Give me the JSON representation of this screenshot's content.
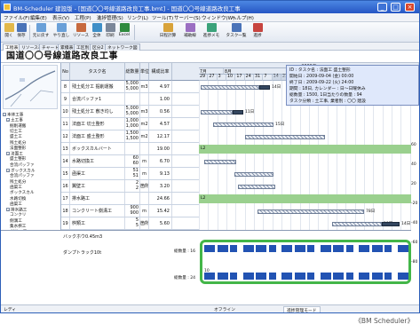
{
  "window": {
    "title": "BM-Scheduler 建設版 - [国道〇〇号線道路改良工事.bmt] - 国道〇〇号線道路改良工事",
    "controls": [
      "_",
      "□",
      "×"
    ]
  },
  "menubar": [
    "ファイル(F)",
    "編集(E)",
    "表示(V)",
    "工程(P)",
    "進捗管理(S)",
    "リンク(L)",
    "ツール(T)",
    "サーバー(S)",
    "ウィンドウ(W)",
    "ヘルプ(H)"
  ],
  "toolbar": [
    {
      "label": "開く",
      "icon": "folder-icon",
      "color": "#e2b84a"
    },
    {
      "label": "保存",
      "icon": "save-icon",
      "color": "#4a73b8"
    },
    {
      "label": "元に戻す",
      "icon": "undo-icon",
      "color": "#6aa0d8"
    },
    {
      "label": "やり直し",
      "icon": "redo-icon",
      "color": "#6aa0d8"
    },
    {
      "label": "リソース",
      "icon": "resource-icon",
      "color": "#c76a3f"
    },
    {
      "label": "全体",
      "icon": "overview-icon",
      "color": "#3f8fc7"
    },
    {
      "label": "印刷",
      "icon": "print-icon",
      "color": "#7b8799"
    },
    {
      "label": "Excel",
      "icon": "excel-icon",
      "color": "#2e8a3e"
    },
    {
      "label": "日程計算",
      "icon": "calc-icon",
      "color": "#d8a33a"
    },
    {
      "label": "補助線",
      "icon": "guide-icon",
      "color": "#9b6fc2"
    },
    {
      "label": "進捗メモ",
      "icon": "memo-icon",
      "color": "#3aa27a"
    },
    {
      "label": "タスク一覧",
      "icon": "tasklist-icon",
      "color": "#4a73b8"
    },
    {
      "label": "進捗",
      "icon": "progress-icon",
      "color": "#c7443f"
    }
  ],
  "tabs": [
    "工程表",
    "リソース表",
    "チャート",
    "累積表",
    "工区別",
    "区分2",
    "ネットワーク図"
  ],
  "project_title": "国道〇〇号線道路改良工事",
  "table": {
    "headers": {
      "no": "No",
      "name": "タスク名",
      "qty": "総数量",
      "unit": "単位",
      "completed": "構成比率"
    },
    "rows": [
      {
        "no": "8",
        "name": "残土処分工 掘削運搬",
        "qty": [
          "5,000",
          "5,000"
        ],
        "unit": "m3",
        "completed": "4.97"
      },
      {
        "no": "9",
        "name": "合流パッファ1",
        "qty": [],
        "unit": "",
        "completed": "1.00"
      },
      {
        "no": "10",
        "name": "残土処分工 敷き均し",
        "qty": [
          "5,000",
          "5,000"
        ],
        "unit": "m3",
        "completed": "0.56"
      },
      {
        "no": "11",
        "name": "法面工 切土整形",
        "qty": [
          "1,000",
          "1,000"
        ],
        "unit": "m2",
        "completed": "4.57"
      },
      {
        "no": "12",
        "name": "法面工 盛土整形",
        "qty": [
          "1,500",
          "1,500"
        ],
        "unit": "m2",
        "completed": "12.17"
      },
      {
        "no": "13",
        "name": "ボックスカルバート",
        "qty": [],
        "unit": "",
        "completed": "19.00"
      },
      {
        "no": "14",
        "name": "水路切換工",
        "qty": [
          "60",
          "60"
        ],
        "unit": "m",
        "completed": "6.70"
      },
      {
        "no": "15",
        "name": "函渠工",
        "qty": [
          "51",
          "51"
        ],
        "unit": "m",
        "completed": "9.13"
      },
      {
        "no": "16",
        "name": "翼壁工",
        "qty": [
          "2",
          "2"
        ],
        "unit": "箇所",
        "completed": "3.20"
      },
      {
        "no": "17",
        "name": "排水路工",
        "qty": [],
        "unit": "",
        "completed": "24.66"
      },
      {
        "no": "18",
        "name": "コンクリート側溝工",
        "qty": [
          "900",
          "900"
        ],
        "unit": "m",
        "completed": "15.42"
      },
      {
        "no": "19",
        "name": "桝類工",
        "qty": [
          "5",
          "5"
        ],
        "unit": "箇所",
        "completed": "5.60"
      }
    ]
  },
  "tree": [
    "本体工事",
    "土工事",
    "掘削運搬",
    "切土工",
    "盛土工",
    "残土処分",
    "法面整形",
    "法面工",
    "盛土整形",
    "合流パッファ",
    "ボックスカル",
    "合流パッファ",
    "残土処分",
    "函渠工",
    "ボックスカル",
    "水路切換",
    "函渠工",
    "排水路工",
    "コンクリ",
    "側溝工",
    "集水桝工",
    "舗装工事",
    "下層路盤",
    "上層路盤",
    "表層工",
    "舗装版",
    "付帯工事",
    "区画線工",
    "ガードレ",
    "交通標識",
    "仮設工事"
  ],
  "gantt": {
    "year_label": "2009年",
    "months": [
      "7月",
      "8月",
      "9月",
      "10月"
    ],
    "days": [
      "29",
      "27",
      "3",
      "10",
      "17",
      "24",
      "31",
      "7",
      "14",
      "21",
      "28",
      "5",
      "12",
      "19",
      "26",
      "2",
      "9",
      "16",
      "23",
      "30",
      "6",
      "13",
      "20",
      "27"
    ],
    "bar_labels": {
      "r8": "14日",
      "r10": "11日",
      "r11": "15日",
      "r13": "L2",
      "r17": "L2",
      "r18": "78日",
      "r19": "19日",
      "r19b": "14日"
    },
    "right_scale": [
      "60",
      "40",
      "20",
      "-20",
      "-40",
      "-60",
      "-80"
    ]
  },
  "tooltip": {
    "lines": [
      "ID : タスク名 : 法面工 盛土整形",
      "開始日 : 2009-09-04 (金) 00:00",
      "終了日 : 2009-09-22 (火) 24:00",
      "期間 : 18日, カレンダー : 日～日曜休み",
      "総数量 : 1500, 1日当たりの数量 : 94",
      "タスク分類 : 土工事, 業者別 : 〇〇 建設"
    ]
  },
  "resource": {
    "label1": "バックホウ0.45m3",
    "label2": "ダンプトラック10t",
    "total1": "総数量 : 16",
    "total2": "総数量 : 24",
    "value1": "10"
  },
  "statusbar": {
    "left": "レディ",
    "mid": "オフライン",
    "right": "進捗管理モード"
  },
  "caption": "《BM Scheduler》"
}
